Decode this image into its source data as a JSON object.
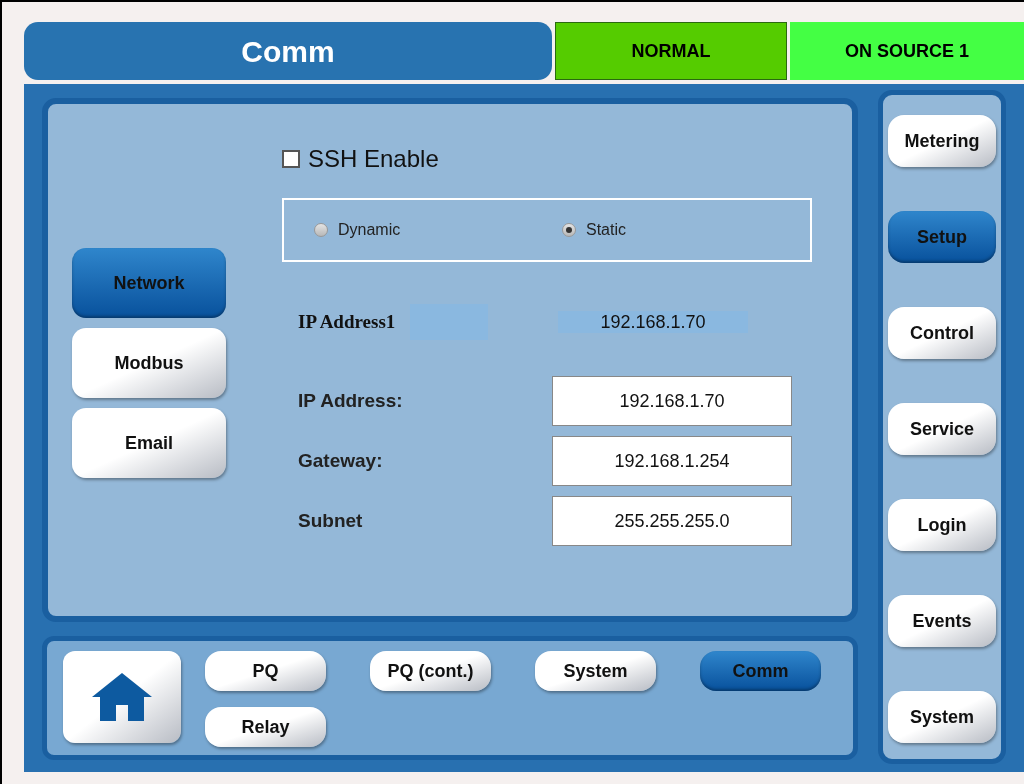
{
  "header": {
    "title": "Comm",
    "status": [
      {
        "text": "NORMAL",
        "color": "#55cc00"
      },
      {
        "text": "ON SOURCE 1",
        "color": "#44ff44"
      }
    ]
  },
  "network_tabs": [
    {
      "label": "Network",
      "selected": true
    },
    {
      "label": "Modbus",
      "selected": false
    },
    {
      "label": "Email",
      "selected": false
    }
  ],
  "ssh": {
    "label": "SSH Enable",
    "checked": false
  },
  "ip_mode": [
    {
      "label": "Dynamic",
      "selected": false
    },
    {
      "label": "Static",
      "selected": true
    }
  ],
  "ip_address1": {
    "label": "IP Address1",
    "value": "192.168.1.70"
  },
  "fields": [
    {
      "label": "IP Address:",
      "value": "192.168.1.70"
    },
    {
      "label": "Gateway:",
      "value": "192.168.1.254"
    },
    {
      "label": "Subnet",
      "value": "255.255.255.0"
    }
  ],
  "bottom_nav": [
    {
      "label": "PQ",
      "selected": false
    },
    {
      "label": "PQ (cont.)",
      "selected": false
    },
    {
      "label": "System",
      "selected": false
    },
    {
      "label": "Comm",
      "selected": true
    },
    {
      "label": "Relay",
      "selected": false
    }
  ],
  "sidebar": [
    {
      "label": "Metering",
      "selected": false
    },
    {
      "label": "Setup",
      "selected": true
    },
    {
      "label": "Control",
      "selected": false
    },
    {
      "label": "Service",
      "selected": false
    },
    {
      "label": "Login",
      "selected": false
    },
    {
      "label": "Events",
      "selected": false
    },
    {
      "label": "System",
      "selected": false
    }
  ]
}
